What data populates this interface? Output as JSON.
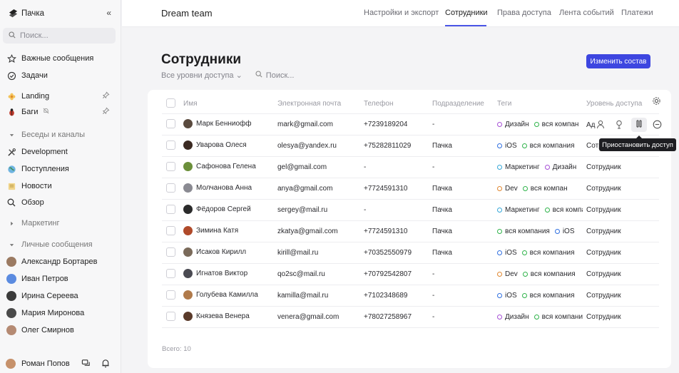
{
  "app": {
    "title": "Пачка",
    "collapse_icon": "«"
  },
  "search": {
    "placeholder": "Поиск..."
  },
  "sidebar": {
    "items": [
      {
        "label": "Важные сообщения",
        "icon": "star-icon"
      },
      {
        "label": "Задачи",
        "icon": "check-circle-icon"
      },
      {
        "label": "Landing",
        "icon": "flower-icon"
      },
      {
        "label": "Баги",
        "icon": "bug-icon"
      },
      {
        "label": "Беседы и каналы",
        "icon": "caret-down-icon"
      },
      {
        "label": "Development",
        "icon": "tools-icon"
      },
      {
        "label": "Поступления",
        "icon": "globe-icon"
      },
      {
        "label": "Новости",
        "icon": "note-icon"
      },
      {
        "label": "Обзор",
        "icon": "search-icon"
      },
      {
        "label": "Маркетинг",
        "icon": "caret-right-icon"
      },
      {
        "label": "Личные сообщения",
        "icon": "caret-down-icon"
      },
      {
        "label": "Александр Бортарев",
        "icon": "avatar"
      },
      {
        "label": "Иван Петров",
        "icon": "avatar"
      },
      {
        "label": "Ирина Сереева",
        "icon": "avatar"
      },
      {
        "label": "Мария Миронова",
        "icon": "avatar"
      },
      {
        "label": "Олег Смирнов",
        "icon": "avatar"
      }
    ],
    "user": {
      "name": "Роман Попов"
    }
  },
  "topbar": {
    "team": "Dream team",
    "tabs": [
      "Настройки и экспорт",
      "Сотрудники",
      "Права доступа",
      "Лента событий",
      "Платежи"
    ],
    "active_tab": "Сотрудники",
    "accent": "#4a55e6"
  },
  "main": {
    "title": "Сотрудники",
    "filter_level": "Все уровни доступа",
    "filter_search": "Поиск...",
    "edit_button": "Изменить состав",
    "columns": [
      "Имя",
      "Электронная почта",
      "Телефон",
      "Подразделение",
      "Теги",
      "Уровень доступа"
    ],
    "tooltip": "Приостановить доступ",
    "first_row_level": "Ад",
    "total": "Всего: 10"
  },
  "tag_colors": {
    "Дизайн": "#a64fd6",
    "вся компания": "#2fb34a",
    "iOS": "#2f6fe0",
    "Маркетинг": "#35a7d8",
    "Dev": "#e0872f"
  },
  "rows": [
    {
      "name": "Марк Беннио​фф",
      "email": "mark@gmail.com",
      "phone": "+7239189204",
      "dept": "-",
      "tags": [
        "Дизайн",
        "вся компан"
      ],
      "tag_keys": [
        "Дизайн",
        "вся компания"
      ],
      "level": ""
    },
    {
      "name": "Уварова Олеся",
      "email": "olesya@yandex.ru",
      "phone": "+75282811029",
      "dept": "Пачка",
      "tags": [
        "iOS",
        "вся компания"
      ],
      "tag_keys": [
        "iOS",
        "вся компания"
      ],
      "level": "Сотр"
    },
    {
      "name": "Сафонова Гелена",
      "email": "gel@gmail.com",
      "phone": "-",
      "dept": "-",
      "tags": [
        "Маркетинг",
        "Дизайн"
      ],
      "tag_keys": [
        "Маркетинг",
        "Дизайн"
      ],
      "level": "Сотрудник"
    },
    {
      "name": "Молчанова Анна",
      "email": "anya@gmail.com",
      "phone": "+7724591310",
      "dept": "Пачка",
      "tags": [
        "Dev",
        "вся компан"
      ],
      "tag_keys": [
        "Dev",
        "вся компания"
      ],
      "level": "Сотрудник"
    },
    {
      "name": "Фёдоров Сергей",
      "email": "sergey@mail.ru",
      "phone": "-",
      "dept": "Пачка",
      "tags": [
        "Маркетинг",
        "вся компа"
      ],
      "tag_keys": [
        "Маркетинг",
        "вся компания"
      ],
      "level": "Сотрудник"
    },
    {
      "name": "Зимина Катя",
      "email": "zkatya@gmail.com",
      "phone": "+7724591310",
      "dept": "Пачка",
      "tags": [
        "вся компания",
        "iOS"
      ],
      "tag_keys": [
        "вся компания",
        "iOS"
      ],
      "level": "Сотрудник"
    },
    {
      "name": "Исаков Кирилл",
      "email": "kirill@mail.ru",
      "phone": "+70352550979",
      "dept": "Пачка",
      "tags": [
        "iOS",
        "вся компания"
      ],
      "tag_keys": [
        "iOS",
        "вся компания"
      ],
      "level": "Сотрудник"
    },
    {
      "name": "Игнатов Виктор",
      "email": "qo2sc@mail.ru",
      "phone": "+70792542807",
      "dept": "-",
      "tags": [
        "Dev",
        "вся компания"
      ],
      "tag_keys": [
        "Dev",
        "вся компания"
      ],
      "level": "Сотрудник"
    },
    {
      "name": "Голубева Камилла",
      "email": "kamilla@mail.ru",
      "phone": "+7102348689",
      "dept": "-",
      "tags": [
        "iOS",
        "вся компания"
      ],
      "tag_keys": [
        "iOS",
        "вся компания"
      ],
      "level": "Сотрудник"
    },
    {
      "name": "Князева Венера",
      "email": "venera@gmail.com",
      "phone": "+78027258967",
      "dept": "-",
      "tags": [
        "Дизайн",
        "вся компания"
      ],
      "tag_keys": [
        "Дизайн",
        "вся компания"
      ],
      "level": "Сотрудник"
    }
  ]
}
